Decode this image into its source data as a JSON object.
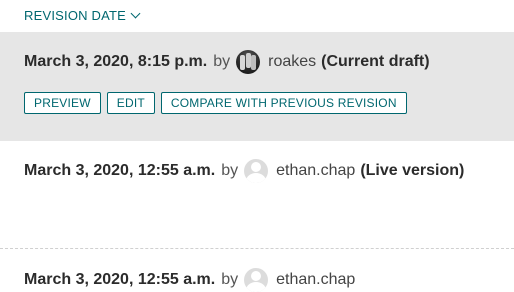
{
  "sort": {
    "label": "REVISION DATE",
    "icon": "chevron-down-icon",
    "color": "#00676f"
  },
  "revisions": [
    {
      "date": "March 3, 2020, 8:15 p.m.",
      "by": "by",
      "user": "roakes",
      "avatar": "user-photo-avatar",
      "status": "(Current draft)",
      "actions": {
        "preview": "PREVIEW",
        "edit": "EDIT",
        "compare": "COMPARE WITH PREVIOUS REVISION"
      }
    },
    {
      "date": "March 3, 2020, 12:55 a.m.",
      "by": "by",
      "user": "ethan.chap",
      "avatar": "default-user-avatar",
      "status": "(Live version)"
    },
    {
      "date": "March 3, 2020, 12:55 a.m.",
      "by": "by",
      "user": "ethan.chap",
      "avatar": "default-user-avatar"
    }
  ],
  "colors": {
    "accent": "#00676f",
    "highlight_bg": "#e6e6e6"
  }
}
